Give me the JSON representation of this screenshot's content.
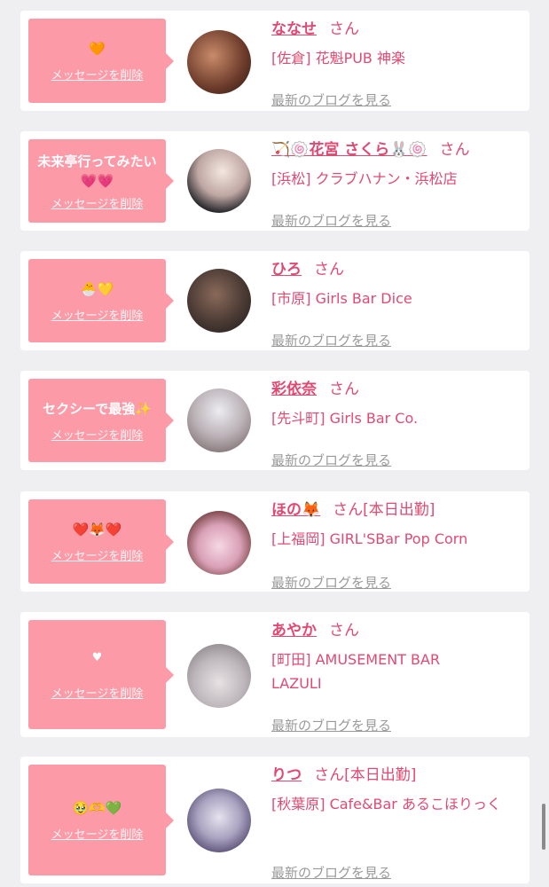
{
  "common": {
    "delete_label": "メッセージを削除",
    "blog_label": "最新のブログを見る",
    "san_label": "さん"
  },
  "colors": {
    "bubble": "#fc9aa8",
    "accent": "#e04a72",
    "page_bg": "#efeff1"
  },
  "items": [
    {
      "message": "🧡",
      "name": "ななせ",
      "status": "",
      "shop": "[佐倉] 花魁PUB 神楽"
    },
    {
      "message": "未来亭行ってみたい💗💗",
      "name": "🏹🍥花宮 さくら🐰🍥",
      "status": "",
      "shop": "[浜松] クラブハナン・浜松店"
    },
    {
      "message": "🐣💛",
      "name": "ひろ",
      "status": "",
      "shop": "[市原] Girls Bar Dice"
    },
    {
      "message": "セクシーで最強✨",
      "name": "彩依奈",
      "status": "",
      "shop": "[先斗町] Girls Bar Co."
    },
    {
      "message": "❤️🦊❤️",
      "name": "ほの🦊",
      "status": "[本日出勤]",
      "shop": "[上福岡] GIRL'SBar Pop Corn"
    },
    {
      "message": "♥",
      "name": "あやか",
      "status": "",
      "shop": "[町田] AMUSEMENT BAR LAZULI"
    },
    {
      "message": "🥹🫶💚",
      "name": "りつ",
      "status": "[本日出勤]",
      "shop": "[秋葉原] Cafe&Bar あるこほりっく"
    }
  ]
}
